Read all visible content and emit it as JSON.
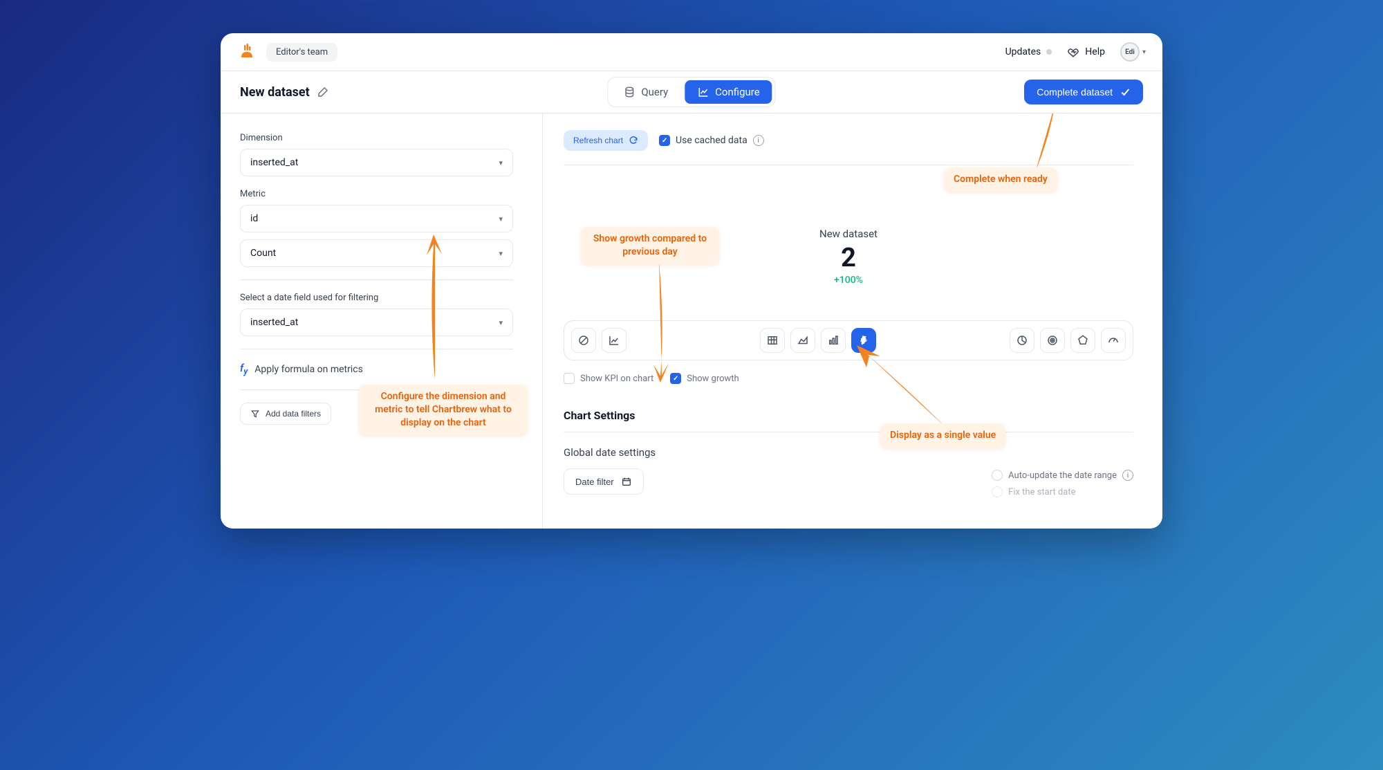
{
  "header": {
    "team_label": "Editor's team",
    "updates_label": "Updates",
    "help_label": "Help",
    "avatar_initials": "Edi"
  },
  "subheader": {
    "page_title": "New dataset",
    "tabs": {
      "query": "Query",
      "configure": "Configure"
    },
    "complete_button": "Complete dataset"
  },
  "left_panel": {
    "dimension_label": "Dimension",
    "dimension_value": "inserted_at",
    "metric_label": "Metric",
    "metric_value": "id",
    "aggregate_value": "Count",
    "date_filter_label": "Select a date field used for filtering",
    "date_filter_value": "inserted_at",
    "formula_label": "Apply formula on metrics",
    "add_filter_label": "Add data filters"
  },
  "right_panel": {
    "refresh_label": "Refresh chart",
    "cache_label": "Use cached data",
    "kpi": {
      "title": "New dataset",
      "value": "2",
      "growth": "+100%"
    },
    "show_kpi_label": "Show KPI on chart",
    "show_growth_label": "Show growth",
    "chart_settings_title": "Chart Settings",
    "global_date_title": "Global date settings",
    "date_filter_btn": "Date filter",
    "auto_update_label": "Auto-update the date range",
    "fix_start_label": "Fix the start date"
  },
  "annotations": {
    "configure_msg": "Configure the dimension and metric to tell Chartbrew what to display on the chart",
    "growth_msg": "Show growth compared to previous day",
    "single_value_msg": "Display as a single value",
    "complete_msg": "Complete when ready"
  }
}
